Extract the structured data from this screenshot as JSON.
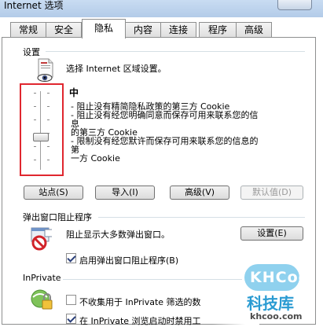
{
  "window": {
    "title": "Internet 选项"
  },
  "tabs": [
    {
      "label": "常规"
    },
    {
      "label": "安全"
    },
    {
      "label": "隐私"
    },
    {
      "label": "内容"
    },
    {
      "label": "连接"
    },
    {
      "label": "程序"
    },
    {
      "label": "高级"
    }
  ],
  "active_tab": "隐私",
  "settings": {
    "heading": "设置",
    "prompt": "选择 Internet 区域设置。",
    "level_title": "中",
    "desc_lines": [
      "- 阻止没有精简隐私政策的第三方 Cookie",
      "- 阻止没有经您明确同意而保存可用来联系您的信息",
      "的第三方 Cookie",
      "- 限制没有经您默许而保存可用来联系您的信息的第",
      "一方 Cookie"
    ],
    "slider_level": "中",
    "buttons": {
      "sites": "站点(S)",
      "import": "导入(I)",
      "advanced": "高级(V)",
      "default": "默认值(D)"
    }
  },
  "popup": {
    "heading": "弹出窗口阻止程序",
    "text": "阻止显示大多数弹出窗口。",
    "settings_button": "设置(E)",
    "enable_label": "启用弹出窗口阻止程序(B)",
    "enable_checked": true
  },
  "inprivate": {
    "heading": "InPrivate",
    "opt1_label": "不收集用于 InPrivate 筛选的数",
    "opt1_checked": false,
    "opt2_label": "在 InPrivate 浏览启动时禁用工",
    "opt2_checked": true
  },
  "watermark": {
    "logo": "KHCoo",
    "name": "科技库",
    "url": "khcoo.com"
  },
  "colors": {
    "highlight_frame": "#e0272f",
    "title_bar": "#b9cfea",
    "watermark_blue": "#2a9bd2"
  }
}
